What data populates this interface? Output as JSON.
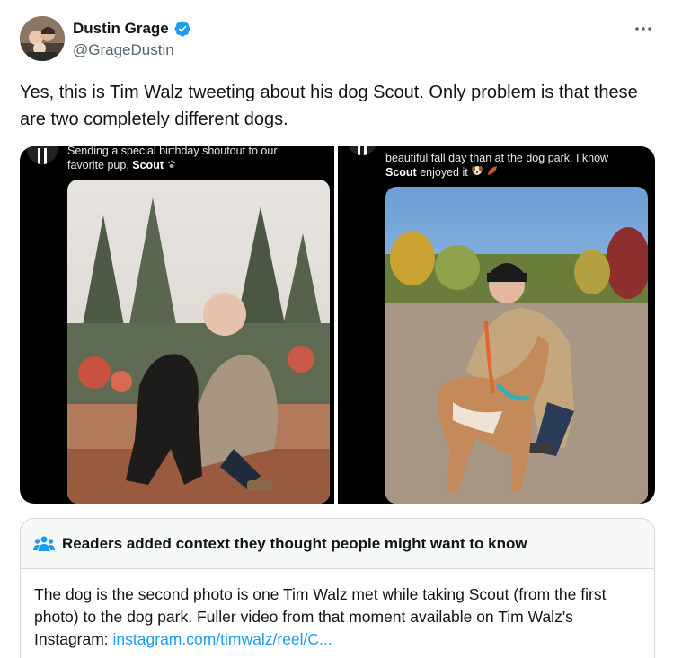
{
  "author": {
    "display_name": "Dustin Grage",
    "handle": "@GrageDustin"
  },
  "icons": [
    "verified-badge-icon",
    "more-options-icon",
    "people-icon",
    "paw-icon",
    "dog-icon",
    "leaf-icon"
  ],
  "tweet": {
    "text": "Yes, this is Tim Walz tweeting about his dog Scout. Only problem is that these are two completely different dogs."
  },
  "media": {
    "left": {
      "caption_prefix": "Sending a special birthday shoutout to our favorite pup, ",
      "caption_bold": "Scout"
    },
    "right": {
      "caption_line1": "beautiful fall day than at the dog park. I know",
      "caption_bold": "Scout",
      "caption_suffix": " enjoyed it"
    }
  },
  "community_note": {
    "header": "Readers added context they thought people might want to know",
    "body": "The dog is the second photo is one Tim Walz met while taking Scout (from the first photo) to the dog park. Fuller video from that moment available on Tim Walz's Instagram: ",
    "link": "instagram.com/timwalz/reel/C..."
  },
  "colors": {
    "text": "#0f1419",
    "secondary": "#536471",
    "link": "#1d9bf0",
    "verified": "#1d9bf0",
    "border": "#cfd9de"
  }
}
